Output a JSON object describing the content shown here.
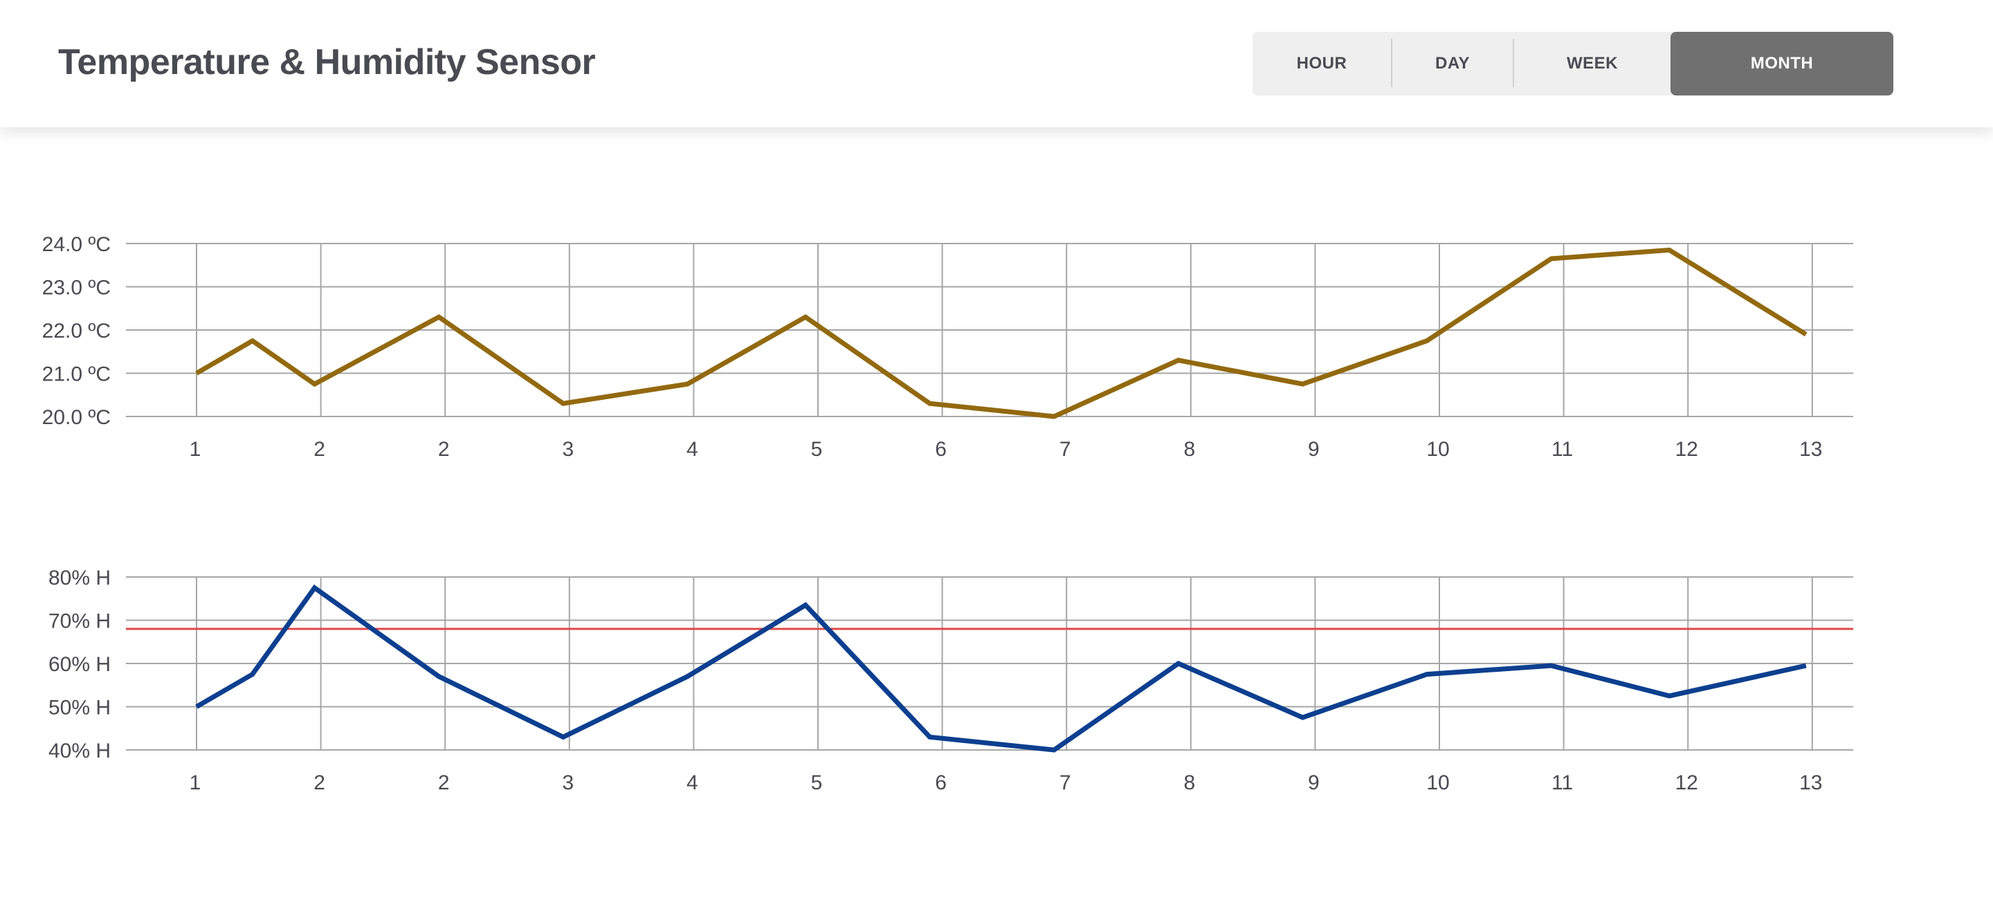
{
  "header": {
    "title": "Temperature & Humidity Sensor"
  },
  "range_selector": {
    "buttons": [
      {
        "label": "HOUR",
        "active": false
      },
      {
        "label": "DAY",
        "active": false
      },
      {
        "label": "WEEK",
        "active": false
      },
      {
        "label": "MONTH",
        "active": true
      }
    ]
  },
  "colors": {
    "temperature_line": "#93690f",
    "humidity_line": "#0c3f8f",
    "threshold_line": "#e04848",
    "grid": "#a6a6a6",
    "active_button": "#707070"
  },
  "chart_data": [
    {
      "type": "line",
      "title": "",
      "xlabel": "",
      "ylabel": "",
      "grid": true,
      "ylim": [
        20,
        24
      ],
      "yticks": [
        "24.0 ºC",
        "23.0 ºC",
        "22.0 ºC",
        "21.0 ºC",
        "20.0 ºC"
      ],
      "xticks": [
        "1",
        "2",
        "2",
        "3",
        "4",
        "5",
        "6",
        "7",
        "8",
        "9",
        "10",
        "11",
        "12",
        "13"
      ],
      "series": [
        {
          "x": [
            0,
            0.45,
            0.95,
            1.95,
            2.95,
            3.95,
            4.9,
            5.9,
            6.9,
            7.9,
            8.9,
            9.9,
            10.9,
            11.85,
            12.95
          ],
          "values": [
            21.0,
            21.75,
            20.75,
            22.3,
            20.3,
            20.75,
            22.3,
            20.3,
            20.0,
            21.3,
            20.75,
            21.75,
            23.65,
            23.85,
            21.9
          ]
        }
      ]
    },
    {
      "type": "line",
      "title": "",
      "xlabel": "",
      "ylabel": "",
      "grid": true,
      "ylim": [
        40,
        80
      ],
      "yticks": [
        "80% H",
        "70% H",
        "60% H",
        "50% H",
        "40% H"
      ],
      "xticks": [
        "1",
        "2",
        "2",
        "3",
        "4",
        "5",
        "6",
        "7",
        "8",
        "9",
        "10",
        "11",
        "12",
        "13"
      ],
      "threshold": 68,
      "series": [
        {
          "x": [
            0,
            0.45,
            0.95,
            1.95,
            2.95,
            3.95,
            4.9,
            5.9,
            6.9,
            7.9,
            8.9,
            9.9,
            10.9,
            11.85,
            12.95
          ],
          "values": [
            50,
            57.5,
            77.5,
            57,
            43,
            57,
            73.5,
            43,
            40,
            60,
            47.5,
            57.5,
            59.5,
            52.5,
            59.5
          ]
        }
      ]
    }
  ]
}
